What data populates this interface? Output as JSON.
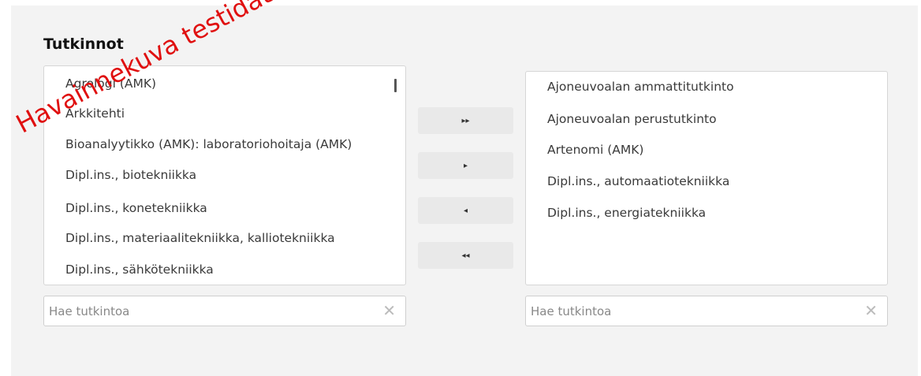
{
  "section": {
    "title": "Tutkinnot"
  },
  "available": {
    "items": [
      "Agrologi (AMK)",
      "Arkkitehti",
      "Bioanalyytikko (AMK): laboratoriohoitaja (AMK)",
      "Dipl.ins., biotekniikka",
      "Dipl.ins., konetekniikka",
      "Dipl.ins., materiaalitekniikka, kalliotekniikka",
      "Dipl.ins., sähkötekniikka"
    ],
    "search_placeholder": "Hae tutkintoa"
  },
  "selected": {
    "items": [
      "Ajoneuvoalan ammattitutkinto",
      "Ajoneuvoalan perustutkinto",
      "Artenomi (AMK)",
      "Dipl.ins., automaatiotekniikka",
      "Dipl.ins., energiatekniikka"
    ],
    "search_placeholder": "Hae tutkintoa"
  },
  "buttons": {
    "move_all_right": "▸▸",
    "move_right": "▸",
    "move_left": "◂",
    "move_all_left": "◂◂"
  },
  "clear_glyph": "✕",
  "watermark": "Havainnekuva testidatalla",
  "colors": {
    "watermark": "#e01010",
    "panel_bg": "#f3f3f3"
  }
}
